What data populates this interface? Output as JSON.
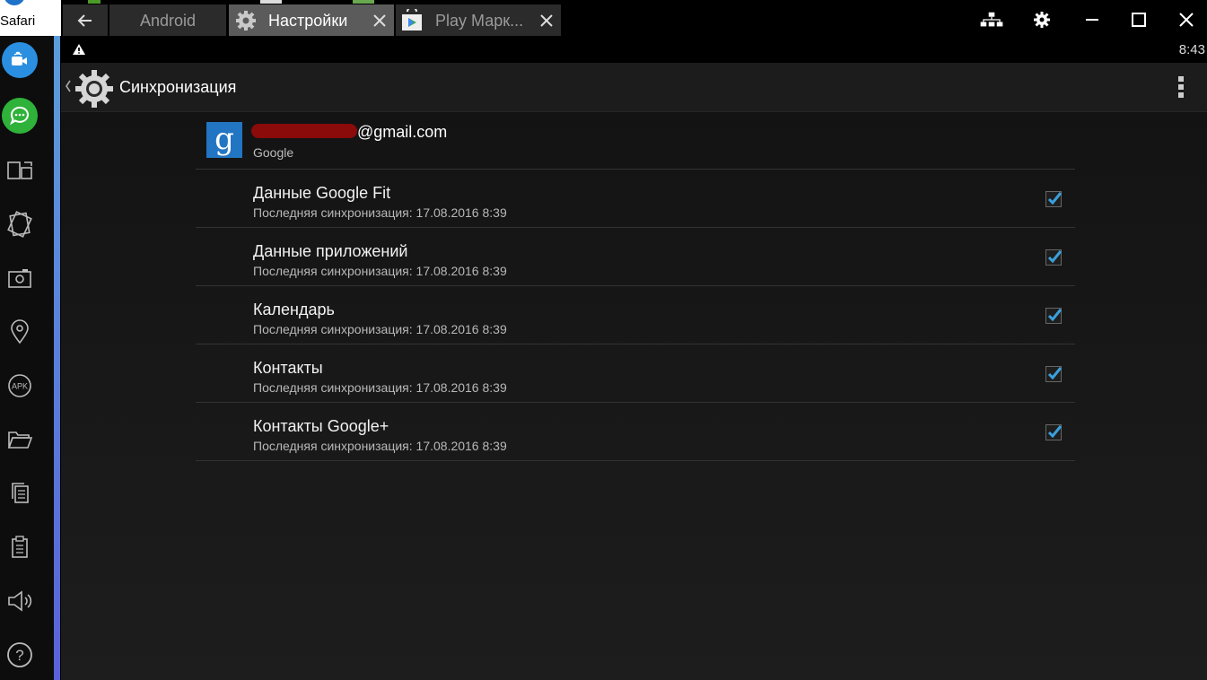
{
  "desktop": {
    "safari_label": "Safari"
  },
  "tabs": {
    "android_label": "Android",
    "settings_label": "Настройки",
    "play_label": "Play  Марк..."
  },
  "status_bar": {
    "time": "8:43"
  },
  "action_bar": {
    "title": "Синхронизация"
  },
  "account": {
    "email_visible": "@gmail.com",
    "type": "Google",
    "logo_letter": "g"
  },
  "sync_items": [
    {
      "title": "Данные Google Fit",
      "subtitle": "Последняя синхронизация: 17.08.2016 8:39",
      "checked": true
    },
    {
      "title": "Данные приложений",
      "subtitle": "Последняя синхронизация: 17.08.2016 8:39",
      "checked": true
    },
    {
      "title": "Календарь",
      "subtitle": "Последняя синхронизация: 17.08.2016 8:39",
      "checked": true
    },
    {
      "title": "Контакты",
      "subtitle": "Последняя синхронизация: 17.08.2016 8:39",
      "checked": true
    },
    {
      "title": "Контакты Google+",
      "subtitle": "Последняя синхронизация: 17.08.2016 8:39",
      "checked": true
    }
  ],
  "colors": {
    "checkmark": "#3aa0dc",
    "sidebar_accent": "#5a62d8",
    "google_blue": "#2275c3"
  }
}
